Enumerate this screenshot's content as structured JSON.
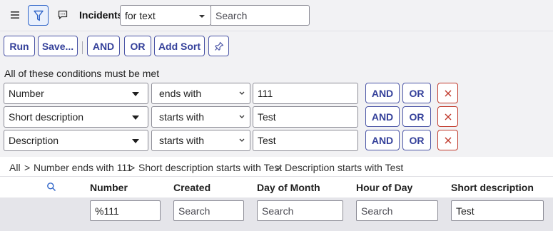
{
  "header": {
    "title": "Incidents",
    "search_scope": "for text",
    "search_placeholder": "Search"
  },
  "toolbar": {
    "run_label": "Run",
    "save_label": "Save...",
    "and_label": "AND",
    "or_label": "OR",
    "add_sort_label": "Add Sort"
  },
  "conditions": {
    "heading": "All of these conditions must be met",
    "rows": [
      {
        "field": "Number",
        "operator": "ends with",
        "value": "111",
        "and_label": "AND",
        "or_label": "OR"
      },
      {
        "field": "Short description",
        "operator": "starts with",
        "value": "Test",
        "and_label": "AND",
        "or_label": "OR"
      },
      {
        "field": "Description",
        "operator": "starts with",
        "value": "Test",
        "and_label": "AND",
        "or_label": "OR"
      }
    ]
  },
  "breadcrumb": {
    "items": [
      "All",
      "Number ends with 111",
      "Short description starts with Test",
      "Description starts with Test"
    ],
    "separator": ">"
  },
  "table": {
    "columns": [
      "Number",
      "Created",
      "Day of Month",
      "Hour of Day",
      "Short description"
    ],
    "filters": [
      {
        "value": "%111",
        "placeholder": "Search"
      },
      {
        "value": "",
        "placeholder": "Search"
      },
      {
        "value": "",
        "placeholder": "Search"
      },
      {
        "value": "",
        "placeholder": "Search"
      },
      {
        "value": "Test",
        "placeholder": "Search"
      }
    ]
  },
  "icons": {
    "menu": "hamburger-icon",
    "filter": "funnel-icon",
    "chat": "chat-icon",
    "pin": "pin-icon",
    "delete": "close-icon",
    "search": "search-icon"
  },
  "colors": {
    "accent": "#34409a",
    "filter_active": "#2e64c8",
    "delete": "#c0392b",
    "panel_bg": "#f2f2f4"
  }
}
